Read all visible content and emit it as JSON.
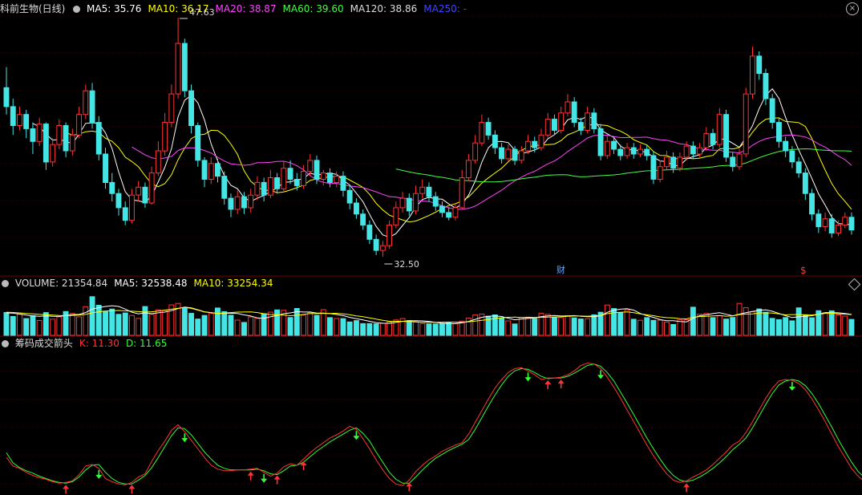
{
  "price_panel": {
    "title": "科前生物(日线)",
    "ma_labels": [
      {
        "text": "MA5: 35.76",
        "color": "#ffffff"
      },
      {
        "text": "MA10: 36.17",
        "color": "#ffff00"
      },
      {
        "text": "MA20: 38.87",
        "color": "#ff44ff"
      },
      {
        "text": "MA60: 39.60",
        "color": "#44ff44"
      },
      {
        "text": "MA120: 38.86",
        "color": "#dddddd"
      },
      {
        "text": "MA250: -",
        "color": "#4444ff"
      }
    ],
    "high_label": "47.63",
    "low_label": "32.50",
    "marker_cai": "财",
    "marker_s": "$"
  },
  "volume_panel": {
    "labels": [
      {
        "text": "VOLUME: 21354.84",
        "color": "#dddddd"
      },
      {
        "text": "MA5: 32538.48",
        "color": "#ffffff"
      },
      {
        "text": "MA10: 33254.34",
        "color": "#ffff00"
      }
    ]
  },
  "indicator_panel": {
    "labels": [
      {
        "text": "筹码成交箭头",
        "color": "#dddddd"
      },
      {
        "text": "K: 11.30",
        "color": "#ff3333"
      },
      {
        "text": "D: 11.65",
        "color": "#33ff33"
      }
    ]
  },
  "colors": {
    "up": "#ff3333",
    "down": "#44e5e5",
    "grid": "#7a0000",
    "k_line": "#ff3333",
    "d_line": "#33ff33",
    "ma5": "#ffffff",
    "ma10": "#ffff00",
    "ma20": "#ff44ff",
    "ma60": "#44ff44",
    "ma120": "#dddddd"
  },
  "chart_data": {
    "type": "candlestick",
    "price_range": [
      32.5,
      47.63
    ],
    "candles": [
      [
        43.2,
        42.0,
        44.5,
        41.5
      ],
      [
        42.0,
        40.8,
        42.5,
        40.2
      ],
      [
        40.8,
        41.5,
        42.0,
        40.5
      ],
      [
        41.5,
        40.6,
        41.8,
        40.0
      ],
      [
        40.6,
        39.8,
        41.0,
        39.0
      ],
      [
        39.8,
        40.9,
        41.3,
        39.5
      ],
      [
        40.9,
        38.5,
        41.0,
        38.0
      ],
      [
        38.5,
        39.6,
        40.0,
        38.2
      ],
      [
        39.6,
        40.8,
        41.2,
        39.3
      ],
      [
        40.8,
        39.2,
        41.0,
        38.8
      ],
      [
        39.2,
        40.2,
        40.6,
        38.9
      ],
      [
        40.2,
        41.5,
        42.0,
        40.0
      ],
      [
        41.5,
        43.0,
        43.4,
        41.2
      ],
      [
        43.0,
        41.0,
        43.5,
        40.6
      ],
      [
        41.0,
        39.0,
        41.4,
        38.6
      ],
      [
        39.0,
        37.2,
        39.4,
        36.8
      ],
      [
        37.2,
        36.5,
        37.8,
        36.0
      ],
      [
        36.5,
        35.6,
        36.8,
        35.1
      ],
      [
        35.6,
        34.8,
        36.0,
        34.5
      ],
      [
        34.8,
        36.4,
        36.8,
        34.6
      ],
      [
        36.4,
        36.9,
        37.3,
        36.0
      ],
      [
        36.9,
        35.9,
        37.2,
        35.6
      ],
      [
        35.9,
        37.8,
        38.2,
        35.8
      ],
      [
        37.8,
        39.2,
        39.8,
        37.6
      ],
      [
        39.2,
        41.0,
        41.6,
        38.9
      ],
      [
        41.0,
        42.8,
        43.4,
        40.7
      ],
      [
        42.8,
        46.0,
        47.63,
        42.5
      ],
      [
        46.0,
        43.0,
        46.3,
        42.6
      ],
      [
        43.0,
        40.8,
        43.4,
        40.3
      ],
      [
        40.8,
        38.6,
        41.0,
        38.2
      ],
      [
        38.6,
        37.4,
        38.8,
        36.9
      ],
      [
        37.4,
        38.4,
        38.8,
        37.1
      ],
      [
        38.4,
        37.6,
        38.7,
        37.2
      ],
      [
        37.6,
        36.2,
        37.9,
        35.8
      ],
      [
        36.2,
        35.5,
        36.5,
        35.0
      ],
      [
        35.5,
        36.3,
        36.7,
        35.2
      ],
      [
        36.3,
        35.6,
        36.6,
        35.2
      ],
      [
        35.6,
        36.4,
        36.8,
        35.3
      ],
      [
        36.4,
        37.2,
        37.6,
        36.1
      ],
      [
        37.2,
        36.4,
        37.5,
        36.0
      ],
      [
        36.4,
        37.5,
        38.0,
        36.2
      ],
      [
        37.5,
        36.8,
        37.8,
        36.5
      ],
      [
        36.8,
        38.1,
        38.5,
        36.6
      ],
      [
        38.1,
        37.4,
        38.6,
        37.1
      ],
      [
        37.4,
        37.0,
        37.8,
        36.7
      ],
      [
        37.0,
        37.9,
        38.3,
        36.8
      ],
      [
        37.9,
        38.6,
        39.0,
        37.6
      ],
      [
        38.6,
        37.4,
        38.9,
        37.1
      ],
      [
        37.4,
        37.8,
        38.0,
        37.0
      ],
      [
        37.8,
        37.2,
        38.1,
        36.9
      ],
      [
        37.2,
        37.6,
        37.9,
        36.9
      ],
      [
        37.6,
        36.7,
        37.9,
        36.3
      ],
      [
        36.7,
        35.9,
        37.0,
        35.5
      ],
      [
        35.9,
        35.2,
        36.2,
        34.9
      ],
      [
        35.2,
        34.5,
        35.5,
        34.2
      ],
      [
        34.5,
        33.6,
        34.8,
        33.3
      ],
      [
        33.6,
        32.9,
        33.9,
        32.6
      ],
      [
        32.9,
        33.2,
        33.5,
        32.5
      ],
      [
        33.2,
        34.5,
        34.8,
        33.0
      ],
      [
        34.5,
        35.6,
        36.0,
        34.3
      ],
      [
        35.6,
        36.2,
        36.6,
        35.3
      ],
      [
        36.2,
        35.4,
        36.5,
        35.1
      ],
      [
        35.4,
        36.5,
        37.0,
        35.2
      ],
      [
        36.5,
        36.9,
        37.4,
        36.2
      ],
      [
        36.9,
        36.3,
        37.2,
        36.0
      ],
      [
        36.3,
        35.7,
        36.6,
        35.4
      ],
      [
        35.7,
        35.3,
        36.0,
        35.0
      ],
      [
        35.3,
        35.0,
        35.6,
        34.8
      ],
      [
        35.0,
        35.6,
        35.9,
        34.8
      ],
      [
        35.6,
        37.5,
        38.0,
        35.5
      ],
      [
        37.5,
        38.6,
        39.0,
        37.3
      ],
      [
        38.6,
        39.7,
        40.2,
        38.4
      ],
      [
        39.7,
        41.0,
        41.5,
        39.5
      ],
      [
        41.0,
        40.2,
        41.3,
        39.9
      ],
      [
        40.2,
        39.4,
        40.5,
        39.0
      ],
      [
        39.4,
        38.7,
        39.7,
        38.4
      ],
      [
        38.7,
        39.3,
        39.6,
        38.5
      ],
      [
        39.3,
        38.6,
        39.5,
        38.3
      ],
      [
        38.6,
        39.2,
        39.5,
        38.4
      ],
      [
        39.2,
        39.8,
        40.2,
        39.0
      ],
      [
        39.8,
        39.4,
        40.1,
        39.1
      ],
      [
        39.4,
        40.2,
        40.6,
        39.2
      ],
      [
        40.2,
        41.2,
        41.6,
        40.0
      ],
      [
        41.2,
        40.5,
        41.5,
        40.2
      ],
      [
        40.5,
        41.6,
        42.0,
        40.3
      ],
      [
        41.6,
        42.3,
        42.8,
        41.4
      ],
      [
        42.3,
        41.0,
        42.6,
        40.7
      ],
      [
        41.0,
        40.5,
        41.3,
        40.2
      ],
      [
        40.5,
        41.6,
        42.0,
        40.3
      ],
      [
        41.6,
        40.6,
        41.9,
        40.3
      ],
      [
        40.6,
        38.9,
        40.9,
        38.6
      ],
      [
        38.9,
        39.8,
        40.2,
        38.7
      ],
      [
        39.8,
        39.3,
        40.1,
        39.0
      ],
      [
        39.3,
        38.9,
        39.6,
        38.6
      ],
      [
        38.9,
        39.4,
        39.7,
        38.7
      ],
      [
        39.4,
        39.0,
        39.7,
        38.7
      ],
      [
        39.0,
        39.3,
        39.6,
        38.8
      ],
      [
        39.3,
        38.9,
        39.6,
        38.6
      ],
      [
        38.9,
        37.4,
        39.2,
        37.1
      ],
      [
        37.4,
        38.2,
        38.6,
        37.2
      ],
      [
        38.2,
        38.8,
        39.2,
        38.0
      ],
      [
        38.8,
        38.1,
        39.1,
        37.8
      ],
      [
        38.1,
        38.8,
        39.1,
        37.9
      ],
      [
        38.8,
        39.5,
        39.8,
        38.6
      ],
      [
        39.5,
        39.0,
        39.8,
        38.7
      ],
      [
        39.0,
        39.4,
        39.7,
        38.8
      ],
      [
        39.4,
        40.3,
        40.7,
        39.2
      ],
      [
        40.3,
        39.6,
        40.6,
        39.3
      ],
      [
        39.6,
        41.5,
        41.9,
        39.4
      ],
      [
        41.5,
        38.8,
        41.8,
        38.5
      ],
      [
        38.8,
        38.2,
        39.1,
        37.9
      ],
      [
        38.2,
        39.0,
        39.3,
        38.0
      ],
      [
        39.0,
        42.8,
        43.2,
        38.8
      ],
      [
        42.8,
        45.2,
        45.8,
        42.5
      ],
      [
        45.2,
        44.1,
        45.5,
        43.7
      ],
      [
        44.1,
        42.5,
        44.4,
        42.1
      ],
      [
        42.5,
        41.0,
        42.8,
        40.6
      ],
      [
        41.0,
        39.8,
        41.3,
        39.4
      ],
      [
        39.8,
        39.2,
        40.1,
        38.8
      ],
      [
        39.2,
        38.5,
        39.5,
        38.1
      ],
      [
        38.5,
        37.8,
        38.8,
        37.5
      ],
      [
        37.8,
        36.5,
        38.1,
        36.1
      ],
      [
        36.5,
        35.2,
        36.8,
        34.8
      ],
      [
        35.2,
        34.4,
        35.5,
        34.0
      ],
      [
        34.4,
        34.9,
        35.3,
        34.1
      ],
      [
        34.9,
        34.0,
        35.2,
        33.7
      ],
      [
        34.0,
        34.5,
        34.8,
        33.8
      ],
      [
        34.5,
        35.0,
        35.3,
        34.3
      ],
      [
        35.0,
        34.2,
        35.3,
        33.9
      ]
    ],
    "volume_range": [
      0,
      60000
    ],
    "volumes": [
      30500,
      25200,
      28600,
      22400,
      26100,
      19800,
      30400,
      21600,
      24800,
      31800,
      29100,
      24600,
      38200,
      51600,
      40200,
      32400,
      35100,
      28100,
      29900,
      26600,
      22600,
      38500,
      28100,
      34100,
      33400,
      40700,
      42600,
      36900,
      29400,
      21700,
      26600,
      29300,
      36500,
      31700,
      26900,
      20400,
      17200,
      24600,
      22700,
      28800,
      31000,
      34000,
      33400,
      23800,
      35900,
      27000,
      30400,
      26700,
      34300,
      23700,
      22500,
      22400,
      17900,
      19700,
      15700,
      15800,
      15400,
      16000,
      17800,
      20600,
      22500,
      19700,
      17900,
      15800,
      15300,
      15200,
      15700,
      16800,
      15800,
      19000,
      23100,
      27400,
      28500,
      25600,
      27300,
      23200,
      19300,
      15200,
      23900,
      23500,
      22500,
      29600,
      28100,
      24000,
      23800,
      26200,
      23400,
      21900,
      22300,
      27400,
      30900,
      40500,
      35800,
      30100,
      34200,
      21500,
      20100,
      23700,
      20000,
      20300,
      17600,
      14600,
      20700,
      20900,
      37600,
      28200,
      29300,
      23700,
      26400,
      21700,
      23900,
      42600,
      36900,
      31500,
      35200,
      30900,
      22700,
      21000,
      23800,
      19400,
      36800,
      27500,
      23500,
      32900,
      30100,
      32800,
      27400,
      25700,
      21300
    ],
    "vol_ma5": [
      30000,
      29600,
      28400,
      27000,
      26000,
      25400,
      26000,
      25500,
      25300,
      26600,
      27500,
      28000,
      30400,
      35000,
      37100,
      38600,
      39500,
      38600,
      35000,
      31000,
      28700,
      30100,
      28900,
      30100,
      31100,
      33000,
      35700,
      37700,
      36600,
      34200,
      31500,
      30400,
      29300,
      29400,
      29600,
      29100,
      27300,
      25800,
      23200,
      22700,
      24700,
      26500,
      28900,
      30000,
      31600,
      31200,
      31200,
      29800,
      29800,
      29000,
      27900,
      26400,
      24000,
      22200,
      20600,
      18700,
      17000,
      16200,
      16000,
      17200,
      18800,
      19400,
      19500,
      19300,
      18600,
      17200,
      16200,
      15500,
      15600,
      16700,
      18600,
      21300,
      24100,
      25500,
      26000,
      25200,
      22800,
      20800,
      21900,
      22600,
      23600,
      24900,
      25900,
      26500,
      25800,
      26000,
      26400,
      25500,
      24900,
      24900,
      26300,
      30800,
      33600,
      34900,
      35600,
      33600,
      29200,
      26200,
      24000,
      21000,
      19600,
      19500,
      18400,
      18000,
      22800,
      26200,
      27300,
      29200,
      30200,
      28200,
      26100,
      28300,
      30300,
      31800,
      33300,
      34100,
      32100,
      29200,
      26200,
      23800,
      24700,
      25500,
      26300,
      28200,
      30400,
      30300,
      30100,
      29300,
      28000
    ],
    "vol_ma10": [
      31000,
      30500,
      30000,
      29300,
      28700,
      28000,
      27500,
      27000,
      26500,
      26300,
      26700,
      27000,
      28000,
      30100,
      31500,
      32400,
      33000,
      33200,
      32700,
      32300,
      31700,
      31100,
      31500,
      32500,
      33600,
      34900,
      36200,
      37400,
      36000,
      33700,
      31200,
      30300,
      29400,
      29900,
      30400,
      31100,
      31200,
      31300,
      30400,
      28900,
      27800,
      27400,
      27000,
      26300,
      26800,
      28000,
      29300,
      29000,
      29400,
      29100,
      29500,
      28600,
      27600,
      26000,
      24900,
      23300,
      21800,
      20100,
      18800,
      18700,
      18600,
      18400,
      17900,
      17500,
      17600,
      17500,
      17600,
      17700,
      17600,
      17600,
      18100,
      19000,
      20100,
      21100,
      22500,
      23600,
      24100,
      24300,
      23900,
      24200,
      23900,
      24000,
      24300,
      24500,
      24800,
      25400,
      25800,
      25800,
      25600,
      26000,
      26700,
      28900,
      30200,
      30800,
      31400,
      30300,
      28700,
      27400,
      26300,
      24600,
      23700,
      23300,
      22200,
      22000,
      24200,
      25100,
      25500,
      26000,
      26400,
      25600,
      26000,
      27700,
      28500,
      28700,
      29900,
      30100,
      29800,
      28600,
      27300,
      27700,
      27700,
      27300,
      27200,
      28000,
      29400,
      29600,
      28800,
      28400,
      27700
    ],
    "k": [
      44,
      33,
      30,
      25,
      21,
      18,
      16,
      13,
      11,
      12,
      14,
      22,
      33,
      35,
      30,
      17,
      13,
      10,
      9,
      12,
      19,
      23,
      39,
      53,
      65,
      79,
      86,
      77,
      66,
      55,
      44,
      34,
      29,
      27,
      27,
      28,
      28,
      29,
      30,
      25,
      20,
      24,
      32,
      36,
      34,
      42,
      50,
      57,
      63,
      69,
      73,
      78,
      84,
      80,
      68,
      55,
      41,
      28,
      17,
      10,
      8,
      15,
      26,
      34,
      41,
      46,
      52,
      56,
      60,
      63,
      74,
      89,
      104,
      119,
      133,
      144,
      153,
      158,
      159,
      155,
      150,
      144,
      146,
      146,
      147,
      150,
      155,
      162,
      165,
      164,
      158,
      147,
      134,
      120,
      105,
      90,
      75,
      60,
      46,
      34,
      23,
      15,
      12,
      14,
      19,
      23,
      28,
      35,
      43,
      51,
      60,
      65,
      76,
      90,
      105,
      120,
      133,
      142,
      144,
      143,
      139,
      131,
      119,
      105,
      90,
      74,
      58,
      44,
      30,
      20,
      13,
      8,
      6,
      5,
      4
    ],
    "d": [
      50,
      37,
      31,
      27,
      24,
      20,
      17,
      14,
      12,
      11,
      13,
      19,
      28,
      34,
      35,
      25,
      17,
      12,
      10,
      10,
      15,
      21,
      31,
      44,
      58,
      72,
      82,
      81,
      73,
      62,
      51,
      42,
      34,
      30,
      28,
      28,
      28,
      28,
      29,
      27,
      23,
      22,
      27,
      33,
      34,
      38,
      45,
      52,
      58,
      64,
      69,
      74,
      79,
      82,
      75,
      65,
      51,
      38,
      25,
      16,
      11,
      11,
      19,
      28,
      36,
      43,
      48,
      53,
      57,
      61,
      67,
      80,
      95,
      110,
      124,
      137,
      148,
      155,
      158,
      157,
      153,
      148,
      145,
      146,
      146,
      148,
      152,
      157,
      162,
      164,
      161,
      153,
      142,
      128,
      114,
      99,
      84,
      69,
      55,
      42,
      30,
      21,
      15,
      13,
      15,
      19,
      24,
      30,
      37,
      45,
      54,
      61,
      69,
      82,
      97,
      112,
      126,
      137,
      142,
      144,
      142,
      136,
      126,
      113,
      98,
      83,
      67,
      52,
      38,
      26,
      18,
      12,
      9,
      7,
      6
    ],
    "k_range": [
      0,
      180
    ]
  }
}
